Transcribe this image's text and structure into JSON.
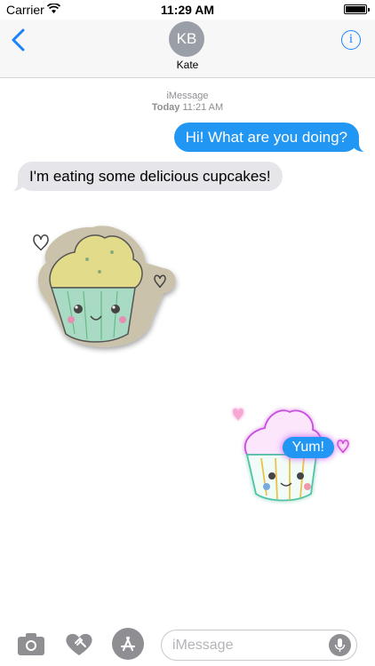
{
  "status": {
    "carrier": "Carrier",
    "time": "11:29 AM"
  },
  "nav": {
    "initials": "KB",
    "name": "Kate",
    "info": "i"
  },
  "timestamp": {
    "service": "iMessage",
    "day": "Today",
    "time": "11:21 AM"
  },
  "messages": [
    {
      "from": "me",
      "text": "Hi! What are you doing?"
    },
    {
      "from": "kate",
      "text": "I'm eating some delicious cupcakes!"
    }
  ],
  "stickers": [
    {
      "name": "cupcake-sticker"
    },
    {
      "name": "cupcake-neon-sticker",
      "overlay_text": "Yum!"
    }
  ],
  "input": {
    "placeholder": "iMessage"
  },
  "colors": {
    "accent": "#1a82fb",
    "outgoing": "#2196f3",
    "incoming": "#e5e5ea"
  }
}
